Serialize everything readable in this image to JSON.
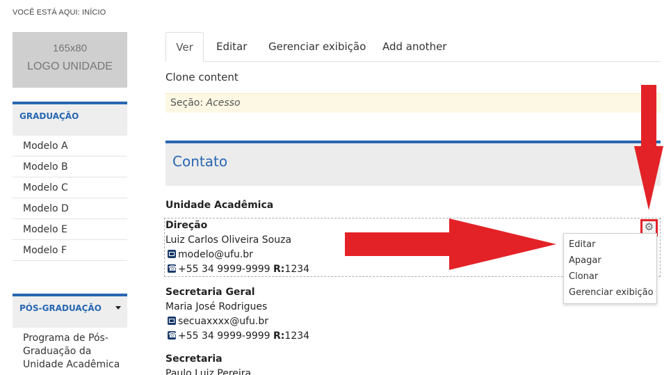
{
  "breadcrumb": "VOCÊ ESTÁ AQUI: INÍCIO",
  "logo": {
    "size": "165x80",
    "label": "LOGO UNIDADE"
  },
  "sidebar": {
    "graduacao": {
      "title": "GRADUAÇÃO",
      "items": [
        "Modelo A",
        "Modelo B",
        "Modelo C",
        "Modelo D",
        "Modelo E",
        "Modelo F"
      ]
    },
    "pos": {
      "title": "PÓS-GRADUAÇÃO",
      "items": [
        "Programa de Pós-Graduação da Unidade Acadêmica"
      ]
    }
  },
  "tabs": [
    "Ver",
    "Editar",
    "Gerenciar exibição",
    "Add another"
  ],
  "clone_label": "Clone content",
  "section": {
    "prefix": "Seção:",
    "value": "Acesso"
  },
  "contato_title": "Contato",
  "unidade_title": "Unidade Acadêmica",
  "contacts": [
    {
      "role": "Direção",
      "name": "Luiz Carlos Oliveira Souza",
      "email": "modelo@ufu.br",
      "phone": "+55 34 9999-9999",
      "ramal_label": "R:",
      "ramal": "1234"
    },
    {
      "role": "Secretaria Geral",
      "name": "Maria José Rodrigues",
      "email": "secuaxxxx@ufu.br",
      "phone": "+55 34 9999-9999",
      "ramal_label": "R:",
      "ramal": "1234"
    },
    {
      "role": "Secretaria",
      "name": "Paulo Luiz Pereira"
    }
  ],
  "dropdown": [
    "Editar",
    "Apagar",
    "Clonar",
    "Gerenciar exibição"
  ],
  "icons": {
    "gear": "gear-icon",
    "mail": "envelope-icon",
    "phone": "phone-icon"
  },
  "colors": {
    "accent": "#2867b2",
    "annotation": "#e32227",
    "notice_bg": "#fcf8e3"
  }
}
